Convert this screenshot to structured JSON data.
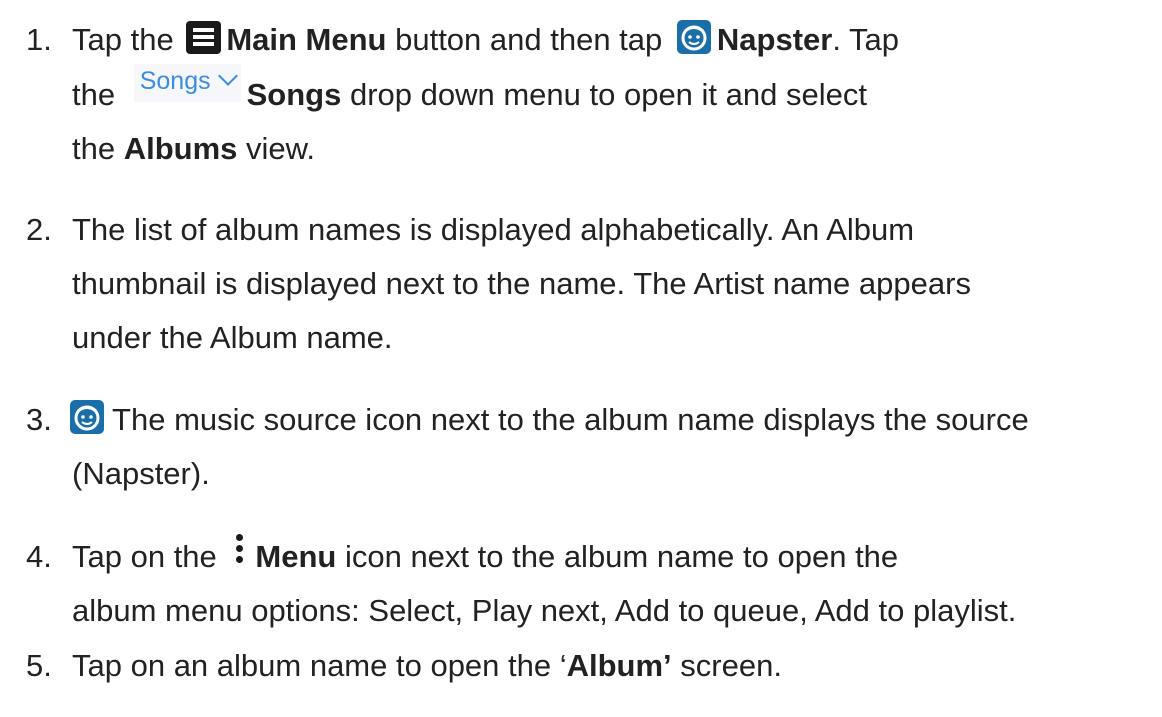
{
  "steps": [
    {
      "number": "1.",
      "lines": [
        {
          "t1": "Tap the ",
          "b1": "Main Menu",
          "t2": " button and then tap ",
          "b2": "Napster",
          "t3": ". Tap"
        },
        {
          "t1": "the ",
          "chip": "Songs",
          "b1": "Songs",
          "t2": " drop down menu to open it and select"
        },
        {
          "t1": "the ",
          "b1": "Albums",
          "t2": " view."
        }
      ]
    },
    {
      "number": "2.",
      "lines": [
        "The list of album names is displayed alphabetically. An Album",
        "thumbnail is displayed next to the name. The Artist name appears",
        "under the Album name."
      ]
    },
    {
      "number": "3.",
      "lines": [
        " The music source icon next to the album name displays the source",
        "(Napster)."
      ]
    },
    {
      "number": "4.",
      "lines": [
        {
          "t1": "Tap on the ",
          "b1": "Menu",
          "t2": " icon next to the album name to open the"
        },
        "album menu options: Select, Play next, Add to queue, Add to playlist."
      ]
    },
    {
      "number": "5.",
      "lines": [
        {
          "t1": "Tap on an album name to open the ‘",
          "b1": "Album’",
          "t2": " screen."
        }
      ]
    }
  ],
  "colors": {
    "text": "#222222",
    "napster_blue": "#1b6fa8",
    "songs_blue": "#3d8ce0"
  },
  "icons": [
    "main-menu-icon",
    "napster-icon",
    "chevron-down-icon",
    "kebab-menu-icon"
  ]
}
